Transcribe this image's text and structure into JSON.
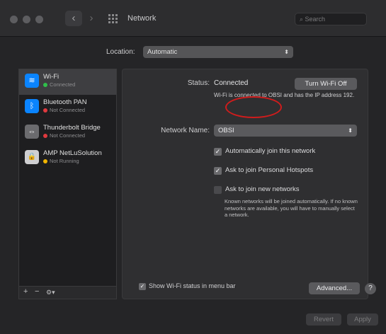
{
  "window": {
    "title": "Network",
    "search_placeholder": "Search",
    "back_glyph": "‹",
    "forward_glyph": "›"
  },
  "location": {
    "label": "Location:",
    "value": "Automatic"
  },
  "sidebar": {
    "items": [
      {
        "name": "Wi-Fi",
        "status": "Connected",
        "status_color": "#2fbf4a",
        "icon": "wifi-icon",
        "icon_bg": "#0a84ff",
        "glyph": "≋"
      },
      {
        "name": "Bluetooth PAN",
        "status": "Not Connected",
        "status_color": "#e0393e",
        "icon": "bluetooth-icon",
        "icon_bg": "#0a84ff",
        "glyph": "ᛒ"
      },
      {
        "name": "Thunderbolt Bridge",
        "status": "Not Connected",
        "status_color": "#e0393e",
        "icon": "thunderbolt-icon",
        "icon_bg": "#6b6b6e",
        "glyph": "⇔"
      },
      {
        "name": "AMP NetLuSolution",
        "status": "Not Running",
        "status_color": "#f0b400",
        "icon": "lock-icon",
        "icon_bg": "#cfcfd1",
        "glyph": "🔒"
      }
    ],
    "footer": {
      "add": "+",
      "remove": "−",
      "actions": "⚙▾"
    }
  },
  "detail": {
    "status_label": "Status:",
    "status_value": "Connected",
    "turn_off_button": "Turn Wi-Fi Off",
    "status_description": "Wi-Fi is connected to OBSI and has the IP address 192.",
    "network_name_label": "Network Name:",
    "network_name_value": "OBSI",
    "auto_join": {
      "label": "Automatically join this network",
      "checked": true
    },
    "personal_hotspot": {
      "label": "Ask to join Personal Hotspots",
      "checked": true
    },
    "ask_new": {
      "label": "Ask to join new networks",
      "checked": false
    },
    "ask_new_description": "Known networks will be joined automatically. If no known networks are available, you will have to manually select a network.",
    "show_status": {
      "label": "Show Wi-Fi status in menu bar",
      "checked": true
    },
    "advanced_button": "Advanced...",
    "help_button": "?"
  },
  "footer": {
    "revert_button": "Revert",
    "apply_button": "Apply"
  }
}
